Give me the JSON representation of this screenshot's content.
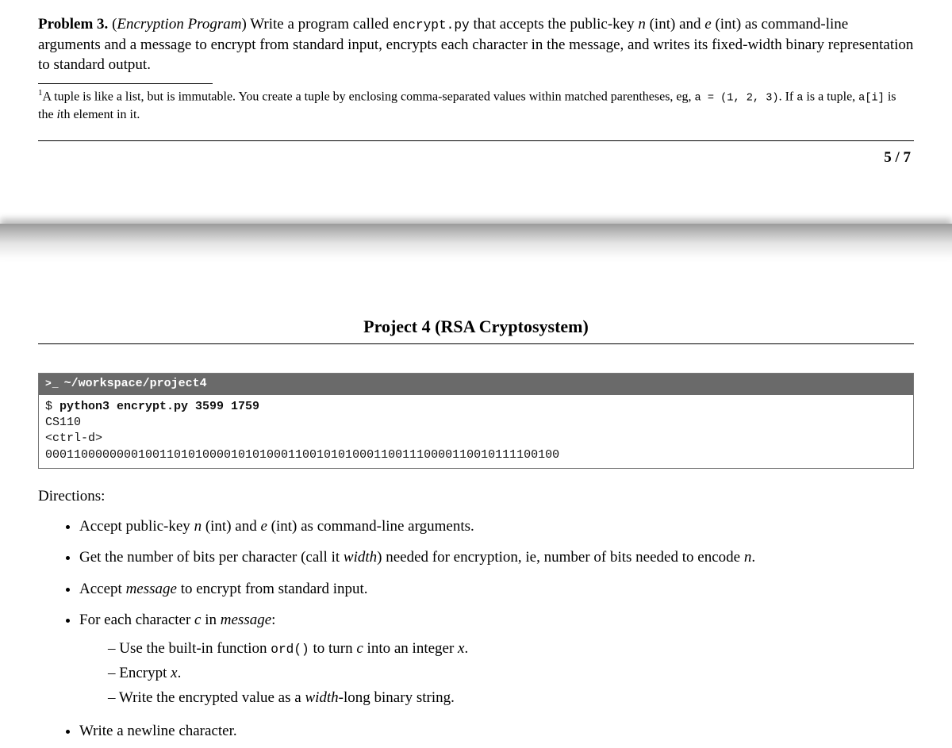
{
  "problem": {
    "label": "Problem 3.",
    "title": "Encryption Program",
    "write_a": "Write a program called ",
    "file": "encrypt.py",
    "desc_1": " that accepts the public-key ",
    "n": "n",
    "int1": " (int) and ",
    "e": "e",
    "int2": " (int) as command-line arguments and a message to encrypt from standard input, encrypts each character in the message, and writes its fixed-width binary representation to standard output."
  },
  "footnote": {
    "sup": "1",
    "text_a": "A tuple is like a list, but is immutable. You create a tuple by enclosing comma-separated values within matched parentheses, eg, ",
    "code_a": "a = (1, 2, 3)",
    "text_b": ". If ",
    "code_b": "a",
    "text_c": " is a tuple, ",
    "code_c": "a[i]",
    "text_d": " is the ",
    "ital_i": "i",
    "text_e": "th element in it."
  },
  "pagenum": "5 / 7",
  "heading": "Project 4 (RSA Cryptosystem)",
  "terminal": {
    "prompt_glyph": ">_",
    "path": "~/workspace/project4",
    "line1_prefix": "$ ",
    "line1_cmd": "python3 encrypt.py 3599 1759",
    "line2": "CS110",
    "line3": "<ctrl-d>",
    "line4": "000110000000010011010100001010100011001010100011001110000110010111100100"
  },
  "directions_label": "Directions:",
  "bullets": {
    "b1a": "Accept public-key ",
    "b1n": "n",
    "b1b": " (int) and ",
    "b1e": "e",
    "b1c": " (int) as command-line arguments.",
    "b2a": "Get the number of bits per character (call it ",
    "b2w": "width",
    "b2b": ") needed for encryption, ie, number of bits needed to encode ",
    "b2n": "n",
    "b2c": ".",
    "b3a": "Accept ",
    "b3m": "message",
    "b3b": " to encrypt from standard input.",
    "b4a": "For each character ",
    "b4c": "c",
    "b4b": " in ",
    "b4m": "message",
    "b4d": ":",
    "d1a": "Use the built-in function ",
    "d1ord": "ord()",
    "d1b": " to turn ",
    "d1c": "c",
    "d1d": " into an integer ",
    "d1x": "x",
    "d1e": ".",
    "d2a": "Encrypt ",
    "d2x": "x",
    "d2b": ".",
    "d3a": "Write the encrypted value as a ",
    "d3w": "width",
    "d3b": "-long binary string.",
    "b5": "Write a newline character."
  }
}
